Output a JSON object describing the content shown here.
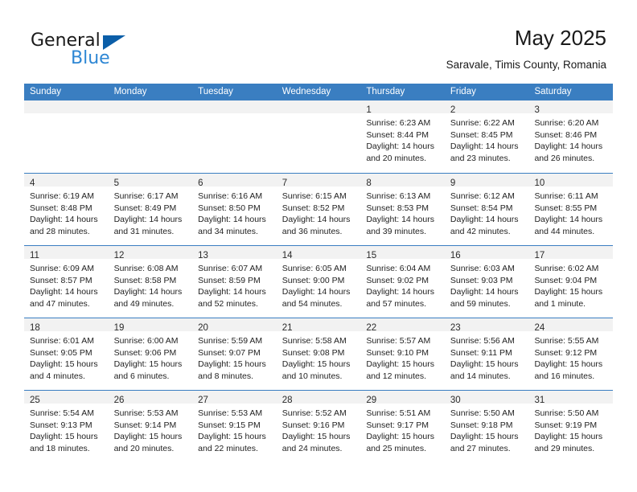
{
  "brand": {
    "name_part1": "General",
    "name_part2": "Blue",
    "accent_color": "#2e87d4",
    "triangle_color": "#0b5ea8",
    "triangle_icon": "triangle-logo-icon"
  },
  "header": {
    "title": "May 2025",
    "subtitle": "Saravale, Timis County, Romania"
  },
  "calendar": {
    "header_bg": "#3a7ec1",
    "day_band_bg": "#f2f2f2",
    "weekday_headers": [
      "Sunday",
      "Monday",
      "Tuesday",
      "Wednesday",
      "Thursday",
      "Friday",
      "Saturday"
    ],
    "weeks": [
      [
        {
          "day": "",
          "lines": []
        },
        {
          "day": "",
          "lines": []
        },
        {
          "day": "",
          "lines": []
        },
        {
          "day": "",
          "lines": []
        },
        {
          "day": "1",
          "lines": [
            "Sunrise: 6:23 AM",
            "Sunset: 8:44 PM",
            "Daylight: 14 hours",
            "and 20 minutes."
          ]
        },
        {
          "day": "2",
          "lines": [
            "Sunrise: 6:22 AM",
            "Sunset: 8:45 PM",
            "Daylight: 14 hours",
            "and 23 minutes."
          ]
        },
        {
          "day": "3",
          "lines": [
            "Sunrise: 6:20 AM",
            "Sunset: 8:46 PM",
            "Daylight: 14 hours",
            "and 26 minutes."
          ]
        }
      ],
      [
        {
          "day": "4",
          "lines": [
            "Sunrise: 6:19 AM",
            "Sunset: 8:48 PM",
            "Daylight: 14 hours",
            "and 28 minutes."
          ]
        },
        {
          "day": "5",
          "lines": [
            "Sunrise: 6:17 AM",
            "Sunset: 8:49 PM",
            "Daylight: 14 hours",
            "and 31 minutes."
          ]
        },
        {
          "day": "6",
          "lines": [
            "Sunrise: 6:16 AM",
            "Sunset: 8:50 PM",
            "Daylight: 14 hours",
            "and 34 minutes."
          ]
        },
        {
          "day": "7",
          "lines": [
            "Sunrise: 6:15 AM",
            "Sunset: 8:52 PM",
            "Daylight: 14 hours",
            "and 36 minutes."
          ]
        },
        {
          "day": "8",
          "lines": [
            "Sunrise: 6:13 AM",
            "Sunset: 8:53 PM",
            "Daylight: 14 hours",
            "and 39 minutes."
          ]
        },
        {
          "day": "9",
          "lines": [
            "Sunrise: 6:12 AM",
            "Sunset: 8:54 PM",
            "Daylight: 14 hours",
            "and 42 minutes."
          ]
        },
        {
          "day": "10",
          "lines": [
            "Sunrise: 6:11 AM",
            "Sunset: 8:55 PM",
            "Daylight: 14 hours",
            "and 44 minutes."
          ]
        }
      ],
      [
        {
          "day": "11",
          "lines": [
            "Sunrise: 6:09 AM",
            "Sunset: 8:57 PM",
            "Daylight: 14 hours",
            "and 47 minutes."
          ]
        },
        {
          "day": "12",
          "lines": [
            "Sunrise: 6:08 AM",
            "Sunset: 8:58 PM",
            "Daylight: 14 hours",
            "and 49 minutes."
          ]
        },
        {
          "day": "13",
          "lines": [
            "Sunrise: 6:07 AM",
            "Sunset: 8:59 PM",
            "Daylight: 14 hours",
            "and 52 minutes."
          ]
        },
        {
          "day": "14",
          "lines": [
            "Sunrise: 6:05 AM",
            "Sunset: 9:00 PM",
            "Daylight: 14 hours",
            "and 54 minutes."
          ]
        },
        {
          "day": "15",
          "lines": [
            "Sunrise: 6:04 AM",
            "Sunset: 9:02 PM",
            "Daylight: 14 hours",
            "and 57 minutes."
          ]
        },
        {
          "day": "16",
          "lines": [
            "Sunrise: 6:03 AM",
            "Sunset: 9:03 PM",
            "Daylight: 14 hours",
            "and 59 minutes."
          ]
        },
        {
          "day": "17",
          "lines": [
            "Sunrise: 6:02 AM",
            "Sunset: 9:04 PM",
            "Daylight: 15 hours",
            "and 1 minute."
          ]
        }
      ],
      [
        {
          "day": "18",
          "lines": [
            "Sunrise: 6:01 AM",
            "Sunset: 9:05 PM",
            "Daylight: 15 hours",
            "and 4 minutes."
          ]
        },
        {
          "day": "19",
          "lines": [
            "Sunrise: 6:00 AM",
            "Sunset: 9:06 PM",
            "Daylight: 15 hours",
            "and 6 minutes."
          ]
        },
        {
          "day": "20",
          "lines": [
            "Sunrise: 5:59 AM",
            "Sunset: 9:07 PM",
            "Daylight: 15 hours",
            "and 8 minutes."
          ]
        },
        {
          "day": "21",
          "lines": [
            "Sunrise: 5:58 AM",
            "Sunset: 9:08 PM",
            "Daylight: 15 hours",
            "and 10 minutes."
          ]
        },
        {
          "day": "22",
          "lines": [
            "Sunrise: 5:57 AM",
            "Sunset: 9:10 PM",
            "Daylight: 15 hours",
            "and 12 minutes."
          ]
        },
        {
          "day": "23",
          "lines": [
            "Sunrise: 5:56 AM",
            "Sunset: 9:11 PM",
            "Daylight: 15 hours",
            "and 14 minutes."
          ]
        },
        {
          "day": "24",
          "lines": [
            "Sunrise: 5:55 AM",
            "Sunset: 9:12 PM",
            "Daylight: 15 hours",
            "and 16 minutes."
          ]
        }
      ],
      [
        {
          "day": "25",
          "lines": [
            "Sunrise: 5:54 AM",
            "Sunset: 9:13 PM",
            "Daylight: 15 hours",
            "and 18 minutes."
          ]
        },
        {
          "day": "26",
          "lines": [
            "Sunrise: 5:53 AM",
            "Sunset: 9:14 PM",
            "Daylight: 15 hours",
            "and 20 minutes."
          ]
        },
        {
          "day": "27",
          "lines": [
            "Sunrise: 5:53 AM",
            "Sunset: 9:15 PM",
            "Daylight: 15 hours",
            "and 22 minutes."
          ]
        },
        {
          "day": "28",
          "lines": [
            "Sunrise: 5:52 AM",
            "Sunset: 9:16 PM",
            "Daylight: 15 hours",
            "and 24 minutes."
          ]
        },
        {
          "day": "29",
          "lines": [
            "Sunrise: 5:51 AM",
            "Sunset: 9:17 PM",
            "Daylight: 15 hours",
            "and 25 minutes."
          ]
        },
        {
          "day": "30",
          "lines": [
            "Sunrise: 5:50 AM",
            "Sunset: 9:18 PM",
            "Daylight: 15 hours",
            "and 27 minutes."
          ]
        },
        {
          "day": "31",
          "lines": [
            "Sunrise: 5:50 AM",
            "Sunset: 9:19 PM",
            "Daylight: 15 hours",
            "and 29 minutes."
          ]
        }
      ]
    ]
  }
}
